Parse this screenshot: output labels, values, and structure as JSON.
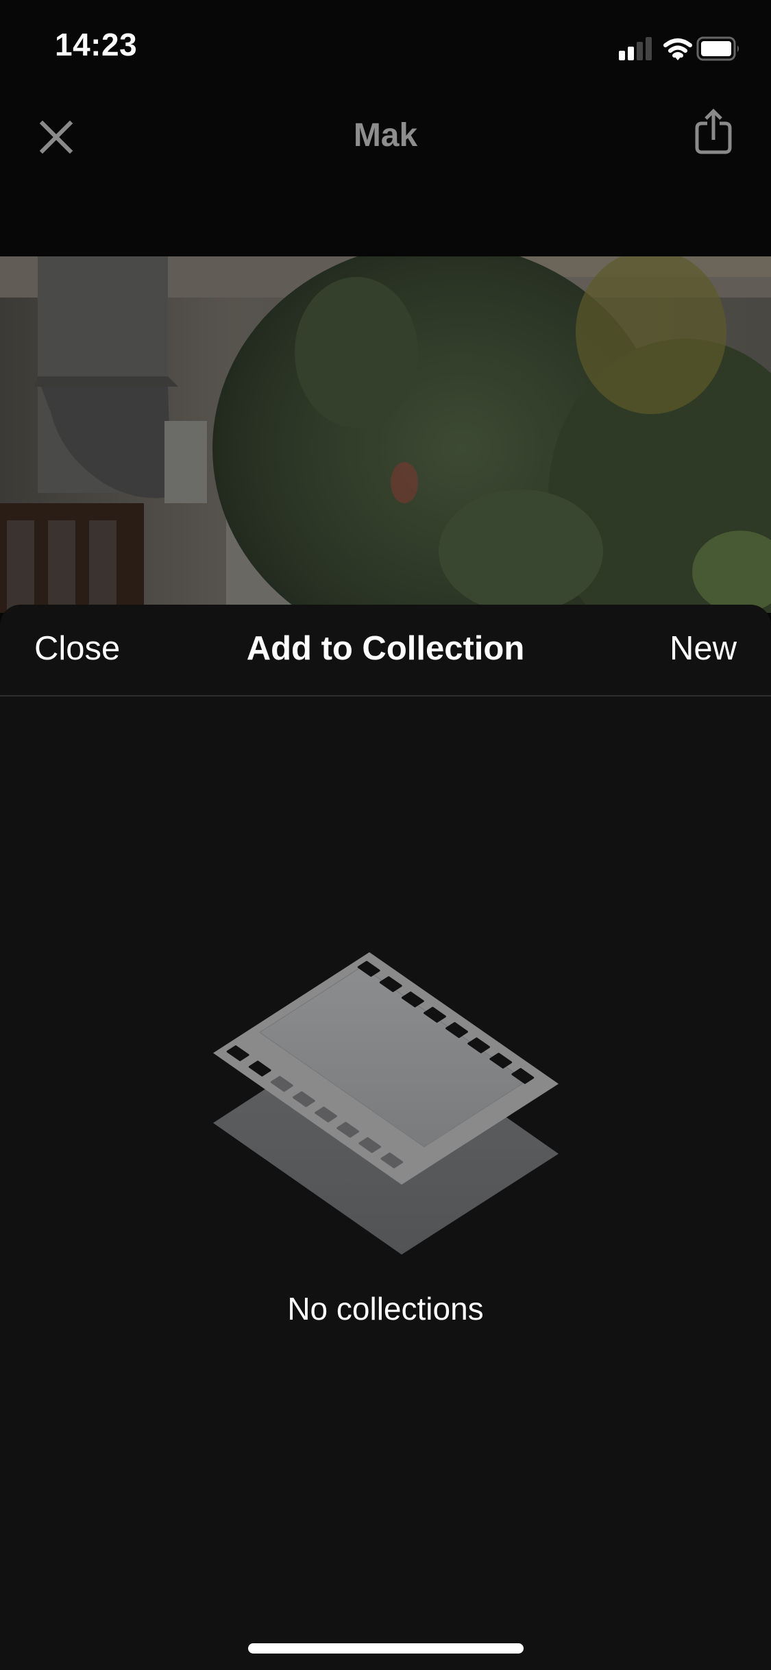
{
  "status_bar": {
    "time": "14:23",
    "signal_bars_active": 2,
    "signal_bars_total": 4,
    "wifi": "wifi-icon",
    "battery_level": 0.9
  },
  "nav": {
    "close_icon": "close-x-icon",
    "title": "Mak",
    "share_icon": "share-icon"
  },
  "photo": {
    "description": "Building facade with ventilation duct and lush green plants"
  },
  "sheet": {
    "close_label": "Close",
    "title": "Add to Collection",
    "new_label": "New",
    "empty_icon": "film-strip-stack-icon",
    "empty_text": "No collections"
  },
  "colors": {
    "background": "#111111",
    "top_background": "#070707",
    "nav_muted": "#8e8e8e",
    "film": "#8a8a8a",
    "film_underlay": "#58595b"
  }
}
